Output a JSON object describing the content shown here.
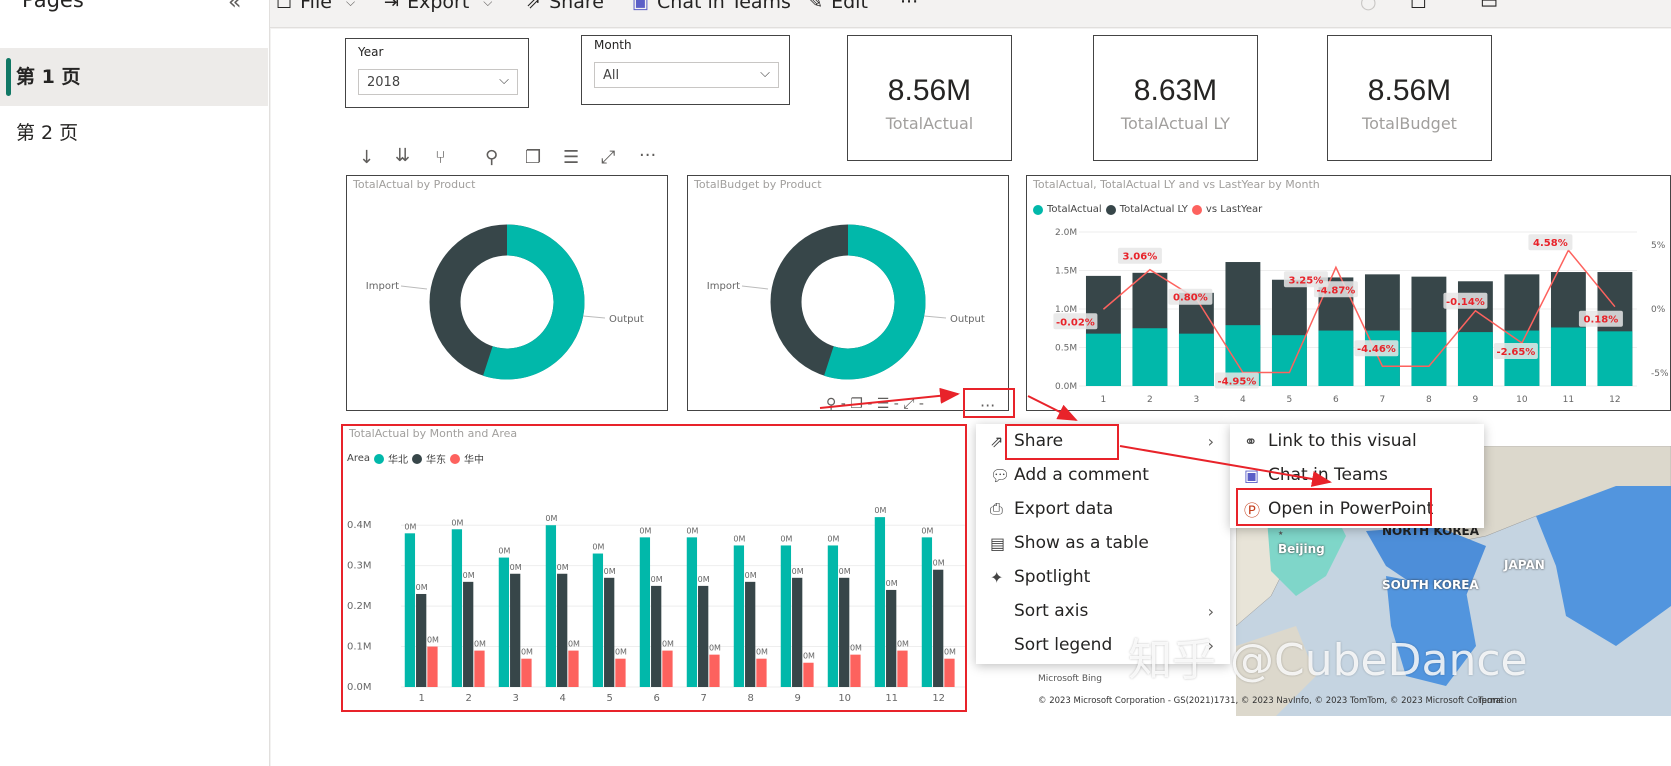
{
  "sidebar": {
    "title": "Pages",
    "collapse_icon": "double-chevron-left-icon",
    "pages": [
      {
        "label": "第 1 页",
        "active": true
      },
      {
        "label": "第 2 页",
        "active": false
      }
    ]
  },
  "toolbar": {
    "file": "File",
    "export": "Export",
    "share": "Share",
    "chat": "Chat in Teams",
    "edit": "Edit",
    "more": "···"
  },
  "slicers": {
    "year": {
      "label": "Year",
      "value": "2018"
    },
    "month": {
      "label": "Month",
      "value": "All"
    }
  },
  "cards": [
    {
      "value": "8.56M",
      "label": "TotalActual"
    },
    {
      "value": "8.63M",
      "label": "TotalActual LY"
    },
    {
      "value": "8.56M",
      "label": "TotalBudget"
    }
  ],
  "visual_header_icons": [
    "sort-descending-icon",
    "expand-all-down-icon",
    "drill-icon",
    "pin-icon",
    "copy-icon",
    "filter-icon",
    "focus-mode-icon",
    "more-options-icon"
  ],
  "donut1": {
    "title": "TotalActual by Product",
    "labels": [
      "Import",
      "Output"
    ]
  },
  "donut2": {
    "title": "TotalBudget by Product",
    "labels": [
      "Import",
      "Output"
    ]
  },
  "combo": {
    "title": "TotalActual, TotalActual LY and vs LastYear by Month",
    "legend": [
      "TotalActual",
      "TotalActual LY",
      "vs LastYear"
    ],
    "y_ticks": [
      "2.0M",
      "1.5M",
      "1.0M",
      "0.5M",
      "0.0M"
    ],
    "y2_ticks": [
      "5%",
      "0%",
      "-5%"
    ]
  },
  "bar": {
    "title": "TotalActual by Month and Area",
    "legend_title": "Area",
    "legend": [
      "华北",
      "华东",
      "华中"
    ],
    "y_ticks": [
      "0.4M",
      "0.3M",
      "0.2M",
      "0.1M",
      "0.0M"
    ],
    "point_label": "0M"
  },
  "hover_more": "···",
  "context_menu": [
    {
      "label": "Share",
      "icon": "share-icon",
      "submenu": true
    },
    {
      "label": "Add a comment",
      "icon": "comment-icon",
      "submenu": false
    },
    {
      "label": "Export data",
      "icon": "export-data-icon",
      "submenu": false
    },
    {
      "label": "Show as a table",
      "icon": "table-icon",
      "submenu": false
    },
    {
      "label": "Spotlight",
      "icon": "spotlight-icon",
      "submenu": false
    },
    {
      "label": "Sort axis",
      "icon": "",
      "submenu": true
    },
    {
      "label": "Sort legend",
      "icon": "",
      "submenu": true
    }
  ],
  "share_submenu": [
    {
      "label": "Link to this visual",
      "icon": "link-icon"
    },
    {
      "label": "Chat in Teams",
      "icon": "teams-icon"
    },
    {
      "label": "Open in PowerPoint",
      "icon": "powerpoint-icon"
    }
  ],
  "map": {
    "labels": [
      "Beijing",
      "NORTH KOREA",
      "SOUTH KOREA",
      "JAPAN"
    ],
    "bing": "Microsoft Bing",
    "copyright": "© 2023 Microsoft Corporation - GS(2021)1731, © 2023 NavInfo, © 2023 TomTom, © 2023 Microsoft Corporation",
    "terms": "Terms"
  },
  "watermark": "知乎 @CubeDance",
  "colors": {
    "teal": "#01b8aa",
    "dark": "#374649",
    "red": "#fd625e",
    "highlight": "#e8232a"
  },
  "chart_data": [
    {
      "type": "pie",
      "title": "TotalActual by Product",
      "categories": [
        "Import",
        "Output"
      ],
      "values": [
        45,
        55
      ]
    },
    {
      "type": "pie",
      "title": "TotalBudget by Product",
      "categories": [
        "Import",
        "Output"
      ],
      "values": [
        45,
        55
      ]
    },
    {
      "type": "bar",
      "title": "TotalActual, TotalActual LY and vs LastYear by Month",
      "categories": [
        "1",
        "2",
        "3",
        "4",
        "5",
        "6",
        "7",
        "8",
        "9",
        "10",
        "11",
        "12"
      ],
      "series": [
        {
          "name": "TotalActual",
          "values": [
            0.68,
            0.75,
            0.68,
            0.79,
            0.66,
            0.72,
            0.72,
            0.7,
            0.7,
            0.72,
            0.76,
            0.71
          ]
        },
        {
          "name": "TotalActual LY",
          "values": [
            1.43,
            1.47,
            1.21,
            1.61,
            1.38,
            1.41,
            1.45,
            1.42,
            1.36,
            1.45,
            1.48,
            1.48
          ]
        },
        {
          "name": "vs LastYear",
          "values": [
            -0.02,
            3.06,
            0.8,
            -4.95,
            -4.95,
            3.25,
            -4.46,
            -4.46,
            -0.14,
            -2.65,
            4.58,
            0.18
          ]
        }
      ],
      "data_labels": [
        "-0.02%",
        "3.06%",
        "0.80%",
        "-4.95%",
        "-4.87%",
        "3.25%",
        "-4.46%",
        "-0.14%",
        "-2.65%",
        "4.58%",
        "0.18%"
      ],
      "ylim": [
        0,
        2.0
      ],
      "y2lim": [
        -6,
        6
      ]
    },
    {
      "type": "bar",
      "title": "TotalActual by Month and Area",
      "categories": [
        "1",
        "2",
        "3",
        "4",
        "5",
        "6",
        "7",
        "8",
        "9",
        "10",
        "11",
        "12"
      ],
      "series": [
        {
          "name": "华北",
          "values": [
            0.38,
            0.39,
            0.32,
            0.4,
            0.33,
            0.37,
            0.37,
            0.35,
            0.35,
            0.35,
            0.42,
            0.37
          ]
        },
        {
          "name": "华东",
          "values": [
            0.23,
            0.26,
            0.28,
            0.28,
            0.27,
            0.25,
            0.25,
            0.26,
            0.27,
            0.27,
            0.24,
            0.29
          ]
        },
        {
          "name": "华中",
          "values": [
            0.1,
            0.09,
            0.07,
            0.09,
            0.07,
            0.09,
            0.08,
            0.07,
            0.06,
            0.08,
            0.09,
            0.07
          ]
        }
      ],
      "ylim": [
        0,
        0.45
      ]
    }
  ]
}
